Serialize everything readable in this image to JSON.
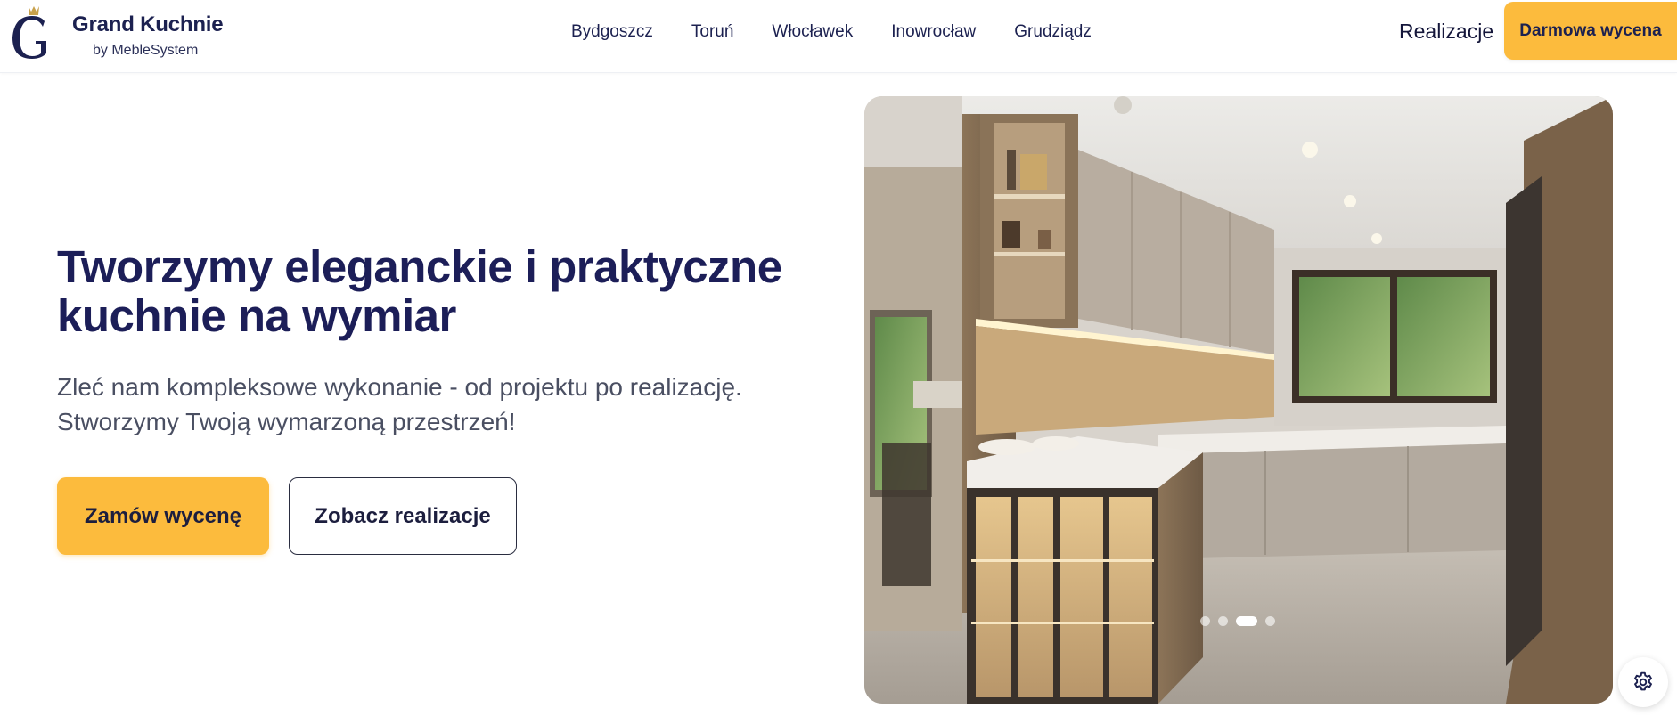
{
  "brand": {
    "name": "Grand Kuchnie",
    "tagline": "by MebleSystem",
    "logo_icon": "crowned-g-icon",
    "colors": {
      "navy": "#1c2150",
      "gold": "#c8a14b",
      "accent": "#fcbb3d"
    }
  },
  "nav": {
    "items": [
      {
        "label": "Bydgoszcz"
      },
      {
        "label": "Toruń"
      },
      {
        "label": "Włocławek"
      },
      {
        "label": "Inowrocław"
      },
      {
        "label": "Grudziądz"
      }
    ],
    "realizacje_label": "Realizacje",
    "cta_label": "Darmowa wycena"
  },
  "hero": {
    "title_line1": "Tworzymy eleganckie i praktyczne",
    "title_line2": "kuchnie na wymiar",
    "subtitle_line1": "Zleć nam kompleksowe wykonanie - od projektu po realizację.",
    "subtitle_line2": "Stworzymy Twoją wymarzoną przestrzeń!",
    "primary_button": "Zamów wycenę",
    "secondary_button": "Zobacz realizacje"
  },
  "carousel": {
    "image": "modern-kitchen-photo",
    "slide_count": 4,
    "active_slide": 3
  },
  "floating": {
    "settings_icon": "gear-icon"
  }
}
